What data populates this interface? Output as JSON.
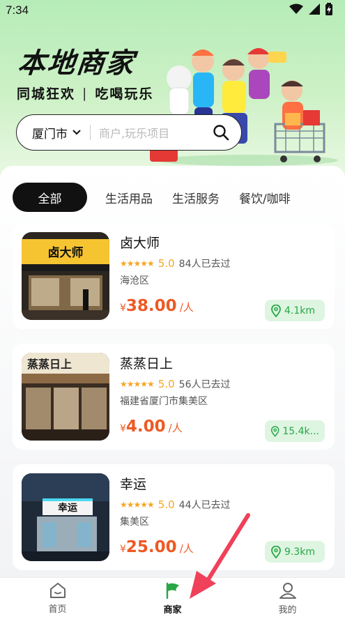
{
  "status": {
    "time": "7:34"
  },
  "hero": {
    "title": "本地商家",
    "sub_left": "同城狂欢",
    "sub_sep": "|",
    "sub_right": "吃喝玩乐"
  },
  "search": {
    "city": "厦门市",
    "placeholder": "商户,玩乐项目"
  },
  "tabs": [
    {
      "label": "全部"
    },
    {
      "label": "生活用品"
    },
    {
      "label": "生活服务"
    },
    {
      "label": "餐饮/咖啡"
    }
  ],
  "merchants": [
    {
      "name": "卤大师",
      "stars": "★★★★★",
      "score": "5.0",
      "visits": "84人已去过",
      "area": "海沧区",
      "currency": "¥",
      "price": "38.00",
      "unit": "/人",
      "distance": "4.1km",
      "sign": "卤大师"
    },
    {
      "name": "蒸蒸日上",
      "stars": "★★★★★",
      "score": "5.0",
      "visits": "56人已去过",
      "area": "福建省厦门市集美区",
      "currency": "¥",
      "price": "4.00",
      "unit": "/人",
      "distance": "15.4k...",
      "sign": "蒸蒸日上"
    },
    {
      "name": "幸运",
      "stars": "★★★★★",
      "score": "5.0",
      "visits": "44人已去过",
      "area": "集美区",
      "currency": "¥",
      "price": "25.00",
      "unit": "/人",
      "distance": "9.3km",
      "sign": "幸运"
    }
  ],
  "nav": [
    {
      "label": "首页",
      "icon": "home-icon"
    },
    {
      "label": "商家",
      "icon": "flag-icon"
    },
    {
      "label": "我的",
      "icon": "user-icon"
    }
  ],
  "colors": {
    "accent": "#27a745",
    "price": "#ee5a24",
    "star": "#f5a623",
    "hero_bg": "#b6ecb8"
  }
}
